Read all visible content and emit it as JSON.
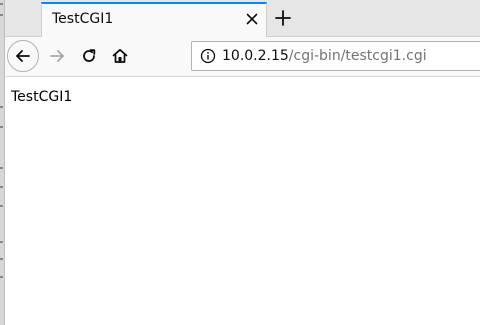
{
  "browser": {
    "accent_color": "#0a84ff",
    "tabs": [
      {
        "title": "TestCGI1",
        "active": true
      }
    ],
    "toolbar": {
      "back_icon": "arrow-left-icon",
      "forward_icon": "arrow-right-icon",
      "reload_icon": "reload-icon",
      "home_icon": "home-icon",
      "new_tab_icon": "plus-icon",
      "close_tab_icon": "close-icon"
    },
    "urlbar": {
      "info_icon": "info-icon",
      "host": "10.0.2.15",
      "path": "/cgi-bin/testcgi1.cgi"
    }
  },
  "page": {
    "body_text": "TestCGI1"
  }
}
